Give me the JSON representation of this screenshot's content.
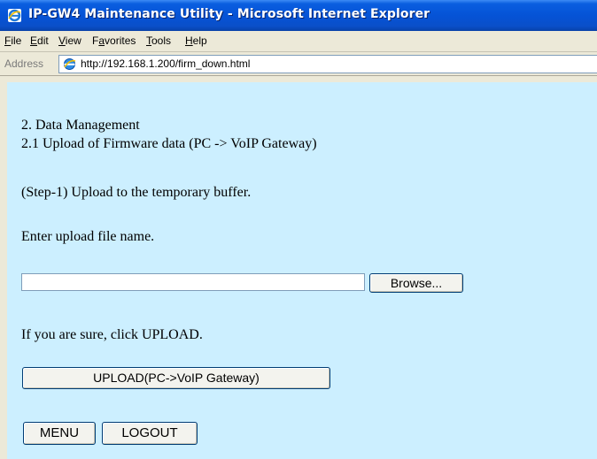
{
  "window": {
    "title": "IP-GW4 Maintenance Utility - Microsoft Internet Explorer"
  },
  "menu": [
    "File",
    "Edit",
    "View",
    "Favorites",
    "Tools",
    "Help"
  ],
  "address": {
    "label": "Address",
    "url": "http://192.168.1.200/firm_down.html"
  },
  "page": {
    "heading": "2. Data Management",
    "subheading": "2.1 Upload of Firmware data (PC -> VoIP Gateway)",
    "step": "(Step-1) Upload to the temporary buffer.",
    "instruction": "Enter upload file name.",
    "file_value": "",
    "browse_label": "Browse...",
    "confirm": "If you are sure, click UPLOAD.",
    "upload_label": "UPLOAD(PC->VoIP Gateway)",
    "menu_label": "MENU",
    "logout_label": "LOGOUT"
  },
  "colors": {
    "titlebar": "#0553d6",
    "content_bg": "#ccefff",
    "chrome": "#ece9d8"
  },
  "icons": {
    "title": "ie-icon",
    "address": "page-icon"
  }
}
